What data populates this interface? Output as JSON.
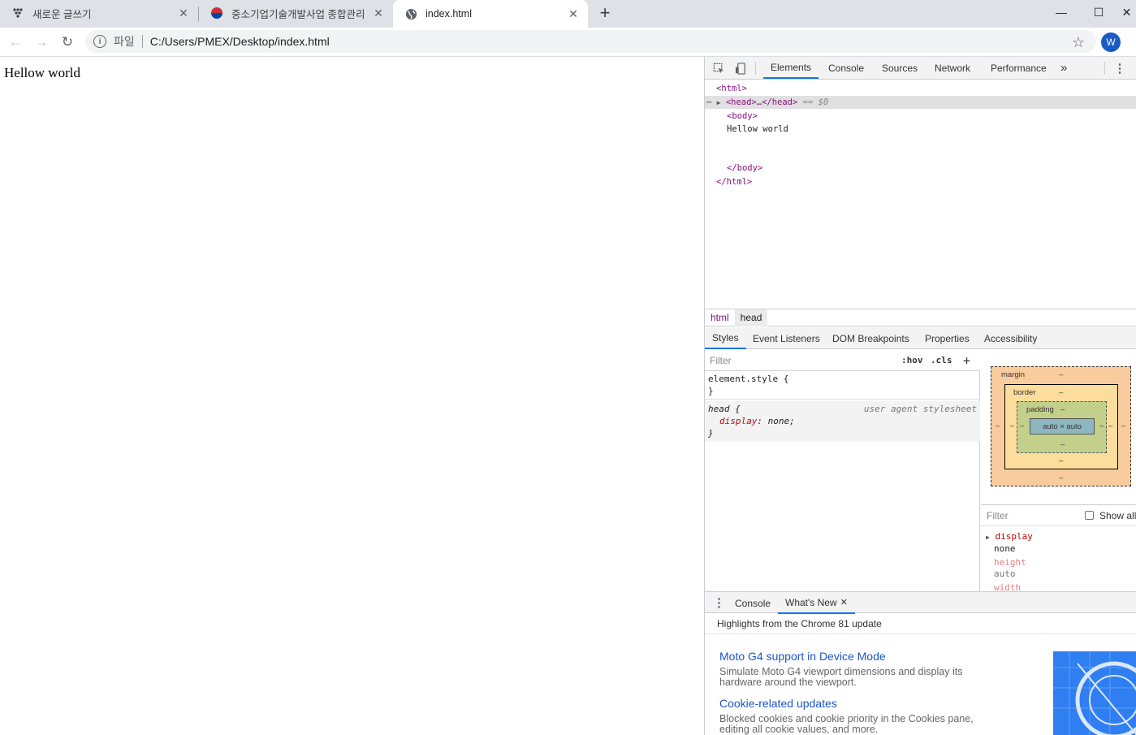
{
  "browser": {
    "tabs": [
      {
        "title": "새로운 글쓰기",
        "icon": "dots-grid-icon",
        "active": false
      },
      {
        "title": "중소기업기술개발사업 종합관리",
        "icon": "korea-flag-icon",
        "active": false
      },
      {
        "title": "index.html",
        "icon": "globe-icon",
        "active": true
      }
    ],
    "new_tab_symbol": "+",
    "window_controls": {
      "minimize": "—",
      "maximize": "☐",
      "close": "✕"
    },
    "address": {
      "scheme": "파일",
      "url": "C:/Users/PMEX/Desktop/index.html"
    },
    "avatar_letter": "W"
  },
  "page": {
    "body_text": "Hellow world"
  },
  "devtools": {
    "main_tabs": [
      "Elements",
      "Console",
      "Sources",
      "Network",
      "Performance"
    ],
    "active_tab": "Elements",
    "more_tabs": "»",
    "dom": [
      {
        "text": "<html>",
        "indent": 0
      },
      {
        "text": "<head>…</head>",
        "suffix": " == $0",
        "indent": 1,
        "selected": true
      },
      {
        "text": "<body>",
        "indent": 2
      },
      {
        "text": "Hellow world",
        "indent": 2,
        "plain": true
      },
      {
        "text": "</body>",
        "indent": 2
      },
      {
        "text": "</html>",
        "indent": 0
      }
    ],
    "breadcrumbs": [
      "html",
      "head"
    ],
    "sub_tabs": [
      "Styles",
      "Event Listeners",
      "DOM Breakpoints",
      "Properties",
      "Accessibility"
    ],
    "styles": {
      "filter_placeholder": "Filter",
      "hov": ":hov",
      "cls": ".cls",
      "add": "+",
      "element_style": "element.style {",
      "close_brace": "}",
      "rule_selector": "head {",
      "rule_source": "user agent stylesheet",
      "rule_property": "display",
      "rule_value": "none;"
    },
    "box_model": {
      "margin": "margin",
      "border": "border",
      "padding": "padding",
      "content": "auto × auto",
      "dash": "–"
    },
    "computed": {
      "filter_placeholder": "Filter",
      "show_all": "Show all",
      "props": [
        {
          "name": "display",
          "value": "none",
          "expandable": true
        },
        {
          "name": "height",
          "value": "auto",
          "expandable": false
        },
        {
          "name": "width",
          "value": "",
          "expandable": false
        }
      ]
    },
    "drawer": {
      "tabs": [
        "Console",
        "What's New"
      ],
      "active_tab": "What's New",
      "heading": "Highlights from the Chrome 81 update",
      "items": [
        {
          "title": "Moto G4 support in Device Mode",
          "desc": "Simulate Moto G4 viewport dimensions and display its hardware around the viewport."
        },
        {
          "title": "Cookie-related updates",
          "desc": "Blocked cookies and cookie priority in the Cookies pane, editing all cookie values, and more."
        }
      ]
    }
  },
  "colors": {
    "tabstrip": "#dee1e6",
    "tag": "#881280",
    "link": "#1a56c9",
    "margin_box": "#f9cc9d",
    "border_box": "#fddd9b",
    "padding_box": "#c3d08b",
    "content_box": "#8cb6c0"
  }
}
